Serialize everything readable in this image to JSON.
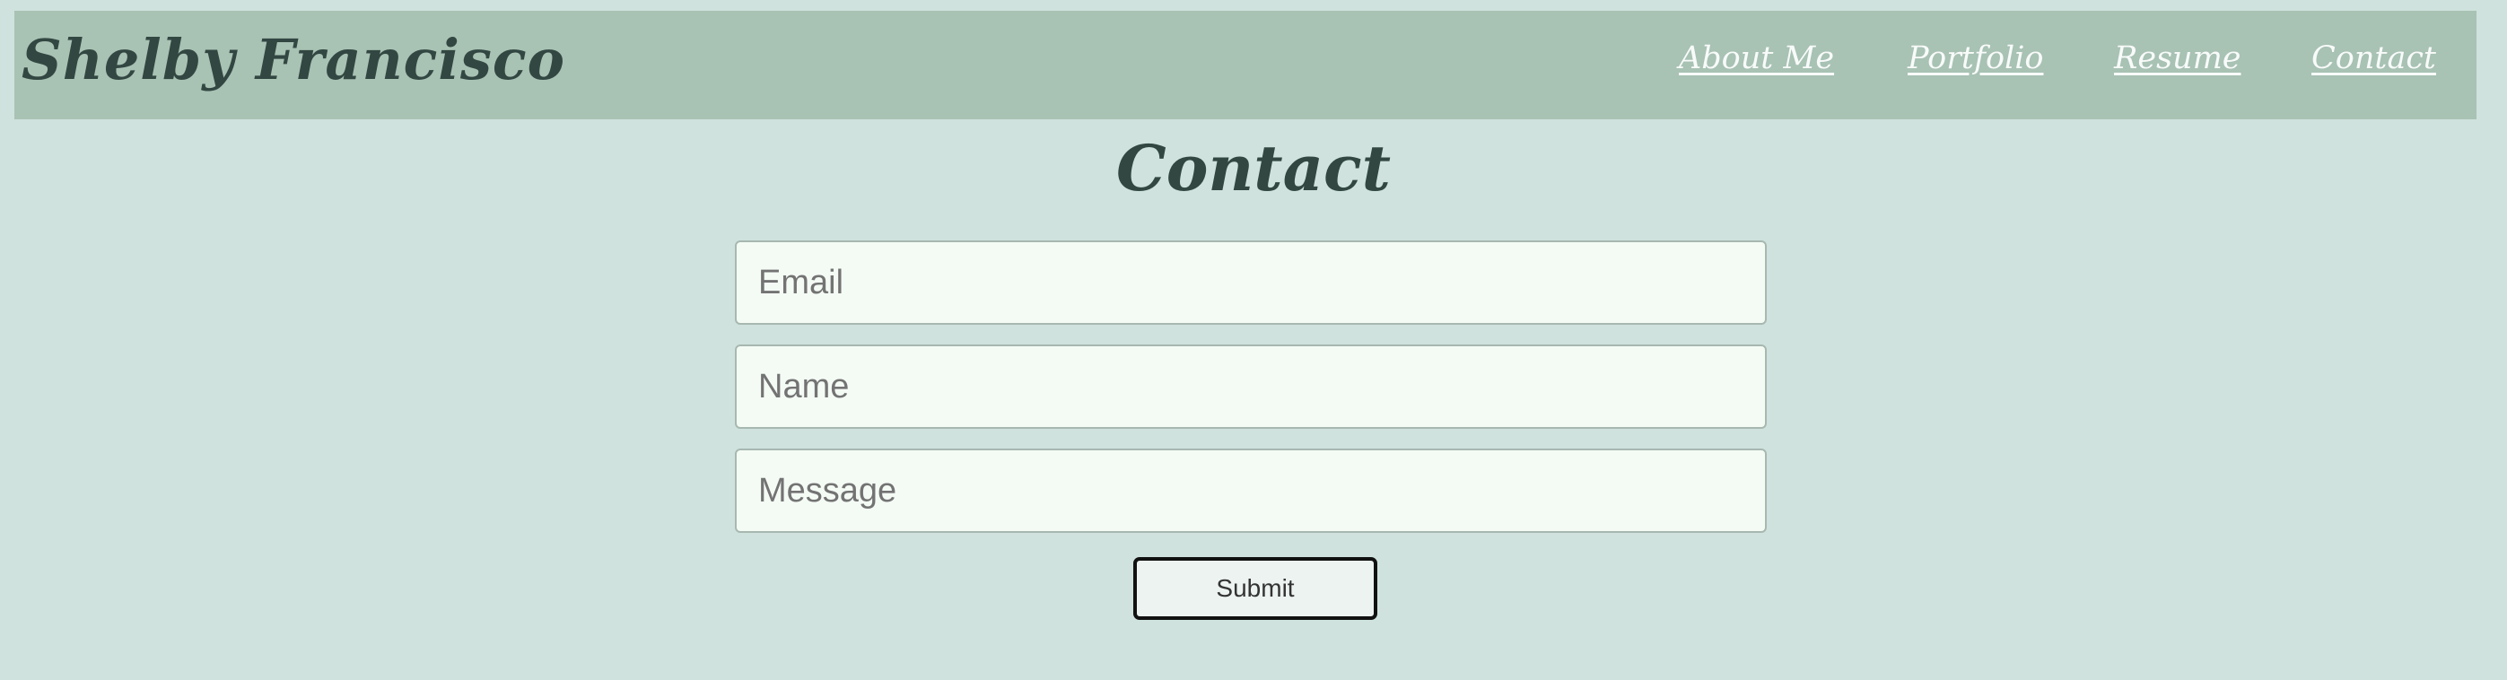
{
  "header": {
    "brand_name": "Shelby Francisco",
    "nav": [
      {
        "label": "About Me"
      },
      {
        "label": "Portfolio"
      },
      {
        "label": "Resume"
      },
      {
        "label": "Contact"
      }
    ]
  },
  "main": {
    "title": "Contact",
    "form": {
      "email_placeholder": "Email",
      "email_value": "",
      "name_placeholder": "Name",
      "name_value": "",
      "message_placeholder": "Message",
      "message_value": "",
      "submit_label": "Submit"
    }
  },
  "colors": {
    "page_background": "#cfe2dd",
    "header_background": "#a8c2b4",
    "heading_text": "#324742",
    "nav_text": "#f8fbfa",
    "input_background": "#f4fbf5",
    "input_border": "#a7b8b1",
    "button_background": "#ecf3f1",
    "button_border": "#111111"
  }
}
